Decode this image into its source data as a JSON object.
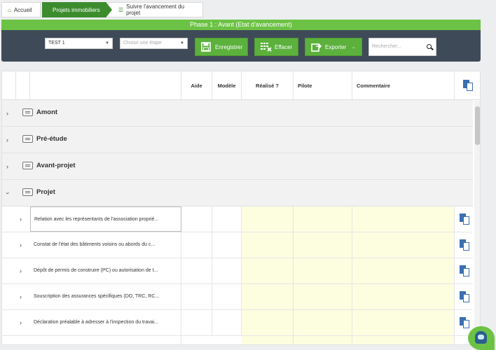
{
  "breadcrumb": {
    "home": "Accueil",
    "projects": "Projets immobiliers",
    "tracking": "Suivre l'avancement du projet"
  },
  "phase_title": "Phase 1 : Avant (Etat d'avancement)",
  "toolbar": {
    "project_select": "TEST 1",
    "step_select_placeholder": "Choisir une étape",
    "save_label": "Enregistrer",
    "clear_label": "Effacer",
    "export_label": "Exporter",
    "search_placeholder": "Rechercher..."
  },
  "table": {
    "headers": {
      "aide": "Aide",
      "modele": "Modèle",
      "realise": "Réalisé ?",
      "pilote": "Pilote",
      "commentaire": "Commentaire"
    },
    "groups": [
      {
        "label": "Amont"
      },
      {
        "label": "Pré-étude"
      },
      {
        "label": "Avant-projet"
      },
      {
        "label": "Projet"
      }
    ],
    "rows": [
      {
        "label": "Relation avec les représentants de l'association proprié..."
      },
      {
        "label": "Constat de l'état des bâtiments voisins ou abords du c..."
      },
      {
        "label": "Dépôt de permis de construire (PC) ou autorisation de t..."
      },
      {
        "label": "Souscription des assurances spécifiques (DO, TRC, RC..."
      },
      {
        "label": "Déclaration préalable à adresser à l'inspection du travai..."
      }
    ]
  },
  "colors": {
    "accent": "#6cc244",
    "dark_green": "#3c8c2e",
    "toolbar_bg": "#3f4a59",
    "highlight": "#fdfde0",
    "icon_blue": "#3a6fb0"
  }
}
